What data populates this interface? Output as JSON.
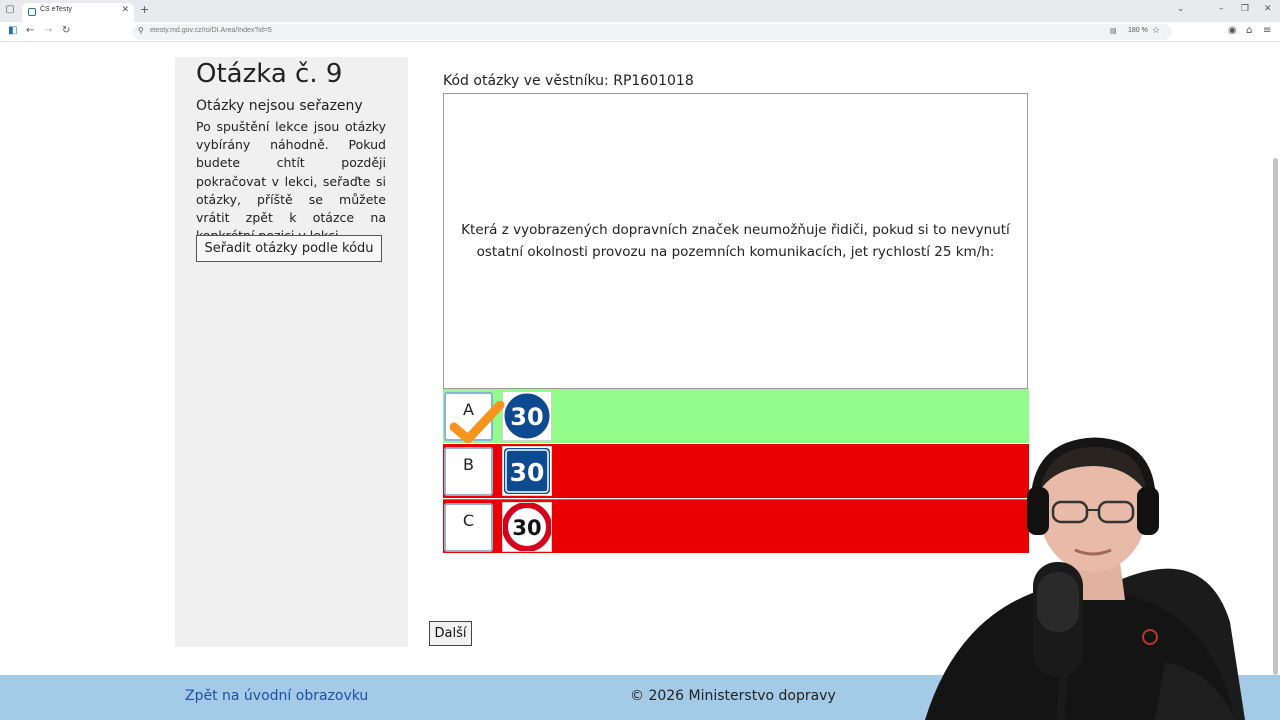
{
  "browser": {
    "tab_title": "ČS eTesty",
    "url": "etesty.md.gov.cz/ro/DI.Area/Index?id=5",
    "zoom": "180 %"
  },
  "sidebar": {
    "question_title": "Otázka č. 9",
    "subtitle": "Otázky nejsou seřazeny",
    "description": "Po spuštění lekce jsou otázky vybírány náhodně. Pokud budete chtít později pokračovat v lekci, seřaďte si otázky, příště se můžete vrátit zpět k otázce na konkrétní pozici v lekci.",
    "sort_button": "Seřadit otázky podle kódu"
  },
  "question": {
    "code_label": "Kód otázky ve věstníku: RP1601018",
    "text": "Která z vyobrazených dopravních značek neumožňuje řidiči, pokud si to nevynutí ostatní okolnosti provozu na pozemních komunikacích, jet rychlostí 25 km/h:"
  },
  "answers": [
    {
      "letter": "A",
      "sign_text": "30",
      "sign": "minimum-speed-sign-icon",
      "state": "correct",
      "color": "#93fb8a"
    },
    {
      "letter": "B",
      "sign_text": "30",
      "sign": "recommended-speed-sign-icon",
      "state": "wrong",
      "color": "#ea0000"
    },
    {
      "letter": "C",
      "sign_text": "30",
      "sign": "speed-limit-sign-icon",
      "state": "wrong",
      "color": "#ea0000"
    }
  ],
  "next_button": "Další",
  "footer": {
    "back_link": "Zpět na úvodní obrazovku",
    "copyright": "© 2026 Ministerstvo dopravy"
  },
  "colors": {
    "footer_bg": "#a3cbe8",
    "correct": "#93fb8a",
    "wrong": "#ea0000",
    "sign_blue": "#0e4a8f",
    "checkmark": "#f7941d"
  }
}
